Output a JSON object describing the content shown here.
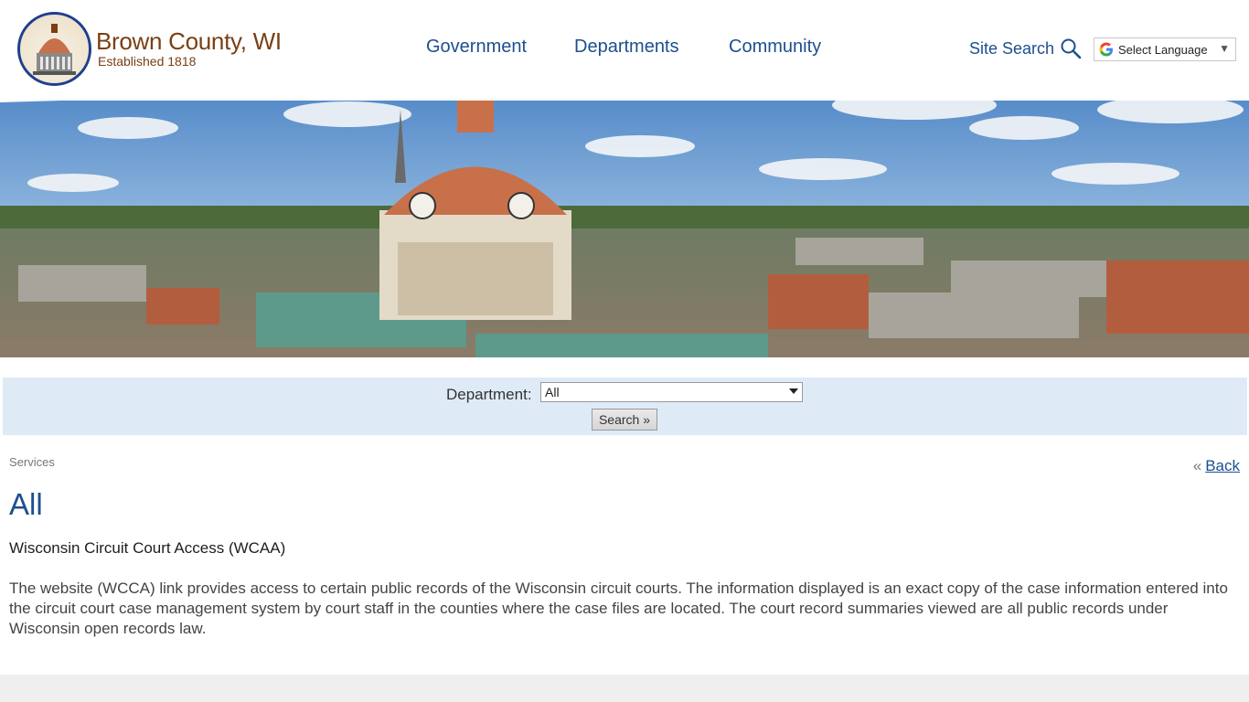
{
  "header": {
    "site_name": "Brown County, WI",
    "tagline": "Established 1818",
    "nav": [
      "Government",
      "Departments",
      "Community"
    ],
    "site_search_label": "Site Search",
    "language_label": "Select Language"
  },
  "filter": {
    "department_label": "Department:",
    "department_selected": "All",
    "search_button": "Search »"
  },
  "content": {
    "breadcrumb": "Services",
    "back_prefix": "«",
    "back_label": "Back",
    "page_title": "All",
    "service_title": "Wisconsin Circuit Court Access (WCAA)",
    "service_description": "The website (WCCA) link provides access to certain public records of the Wisconsin circuit courts. The information displayed is an exact copy of the case information entered into the circuit court case management system by court staff in the counties where the case files are located. The court record summaries viewed are all public records under Wisconsin open records law."
  },
  "colors": {
    "brand_brown": "#7a3f12",
    "nav_blue": "#1d4f8f",
    "filter_bg": "#deebf7"
  }
}
